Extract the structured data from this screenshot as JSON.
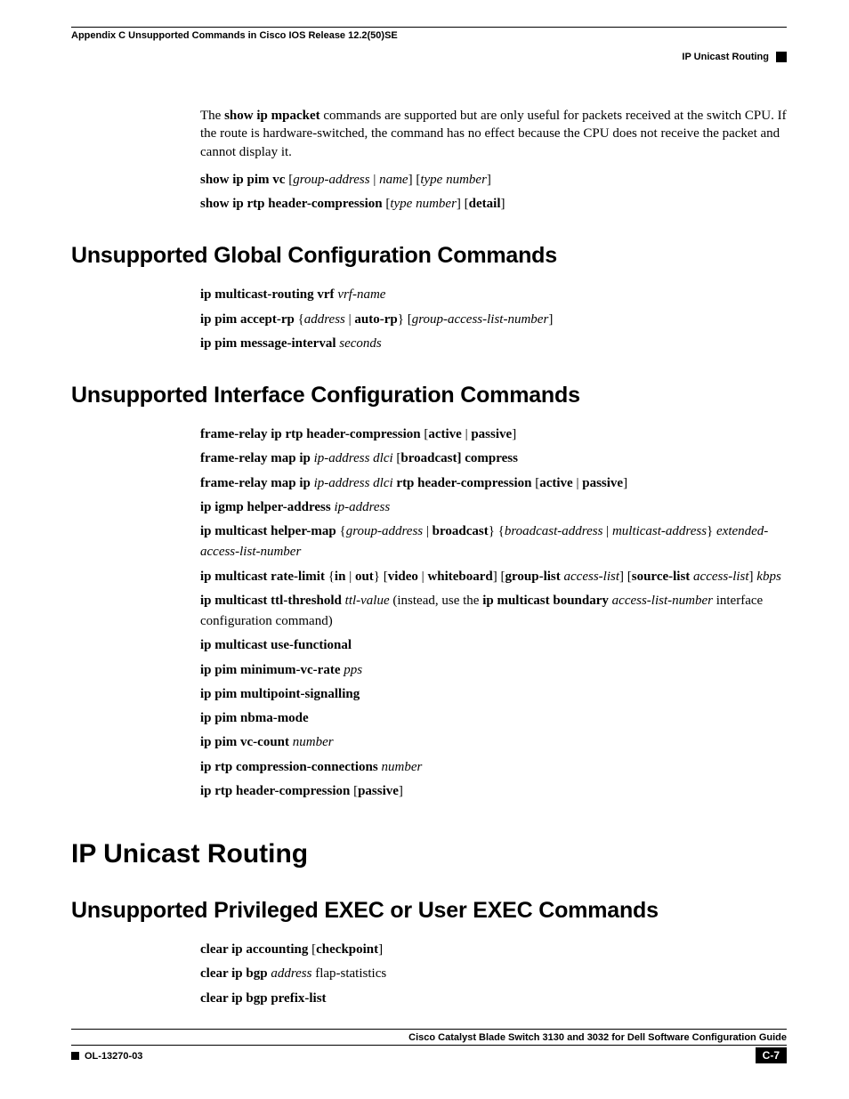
{
  "header": {
    "appendix": "Appendix C      Unsupported Commands in Cisco IOS Release 12.2(50)SE",
    "topic": "IP Unicast Routing"
  },
  "intro": {
    "p1a": "The ",
    "p1b": "show ip mpacket",
    "p1c": " commands are supported but are only useful for packets received at the switch CPU. If the route is hardware-switched, the command has no effect because the CPU does not receive the packet and cannot display it."
  },
  "cmds1": {
    "l1a": "show ip pim vc",
    "l1b": " [",
    "l1c": "group-address",
    "l1d": " | ",
    "l1e": "name",
    "l1f": "] [",
    "l1g": "type number",
    "l1h": "]",
    "l2a": "show ip rtp header-compression",
    "l2b": " [",
    "l2c": "type number",
    "l2d": "] [",
    "l2e": "detail",
    "l2f": "]"
  },
  "sec1": "Unsupported Global Configuration Commands",
  "g1": {
    "a": "ip multicast-routing vrf ",
    "b": "vrf-name"
  },
  "g2": {
    "a": "ip pim accept-rp",
    "b": " {",
    "c": "address",
    "d": " | ",
    "e": "auto-rp",
    "f": "} [",
    "g": "group-access-list-number",
    "h": "]"
  },
  "g3": {
    "a": "ip pim message-interval ",
    "b": "seconds"
  },
  "sec2": "Unsupported Interface Configuration Commands",
  "i1": {
    "a": "frame-relay ip rtp header-compression",
    "b": " [",
    "c": "active",
    "d": " | ",
    "e": "passive",
    "f": "]"
  },
  "i2": {
    "a": "frame-relay map ip ",
    "b": "ip-address dlci",
    "c": " [",
    "d": "broadcast",
    "e": "] compress"
  },
  "i3": {
    "a": "frame-relay map ip ",
    "b": "ip-address dlci ",
    "c": "rtp header-compression",
    "d": " [",
    "e": "active",
    "f": " | ",
    "g": "passive",
    "h": "]"
  },
  "i4": {
    "a": "ip igmp helper-address ",
    "b": "ip-address"
  },
  "i5": {
    "a": "ip multicast helper-map",
    "b": " {",
    "c": "group-address",
    "d": " | ",
    "e": "broadcast",
    "f": "} {",
    "g": "broadcast-address",
    "h": " | ",
    "i": "multicast-address",
    "j": "} ",
    "k": "extended-access-list-number"
  },
  "i6": {
    "a": "ip multicast rate-limit",
    "b": " {",
    "c": "in",
    "d": " | ",
    "e": "out",
    "f": "} [",
    "g": "video",
    "h": " | ",
    "i": "whiteboard",
    "j": "] [",
    "k": "group-list ",
    "l": "access-list",
    "m": "] [",
    "n": "source-list ",
    "o": "access-list",
    "p": "] ",
    "q": "kbps"
  },
  "i7": {
    "a": "ip multicast ttl-threshold ",
    "b": "ttl-value",
    "c": " (instead, use the ",
    "d": "ip multicast boundary ",
    "e": "access-list-number",
    "f": " interface configuration command)"
  },
  "i8": {
    "a": "ip multicast use-functional"
  },
  "i9": {
    "a": "ip pim minimum-vc-rate ",
    "b": "pps"
  },
  "i10": {
    "a": "ip pim multipoint-signalling"
  },
  "i11": {
    "a": "ip pim nbma-mode"
  },
  "i12": {
    "a": "ip pim vc-count ",
    "b": "number"
  },
  "i13": {
    "a": "ip rtp compression-connections ",
    "b": "number"
  },
  "i14": {
    "a": "ip rtp header-compression",
    "b": " [",
    "c": "passive",
    "d": "]"
  },
  "chapter": "IP Unicast Routing",
  "sec3": "Unsupported Privileged EXEC or User EXEC Commands",
  "p1": {
    "a": "clear ip accounting",
    "b": " [",
    "c": "checkpoint",
    "d": "]"
  },
  "p2": {
    "a": "clear ip bgp ",
    "b": "address",
    "c": " flap-statistics"
  },
  "p3": {
    "a": "clear ip bgp prefix-list"
  },
  "footer": {
    "title": "Cisco Catalyst Blade Switch 3130 and 3032 for Dell Software Configuration Guide",
    "docnum": "OL-13270-03",
    "page": "C-7"
  }
}
